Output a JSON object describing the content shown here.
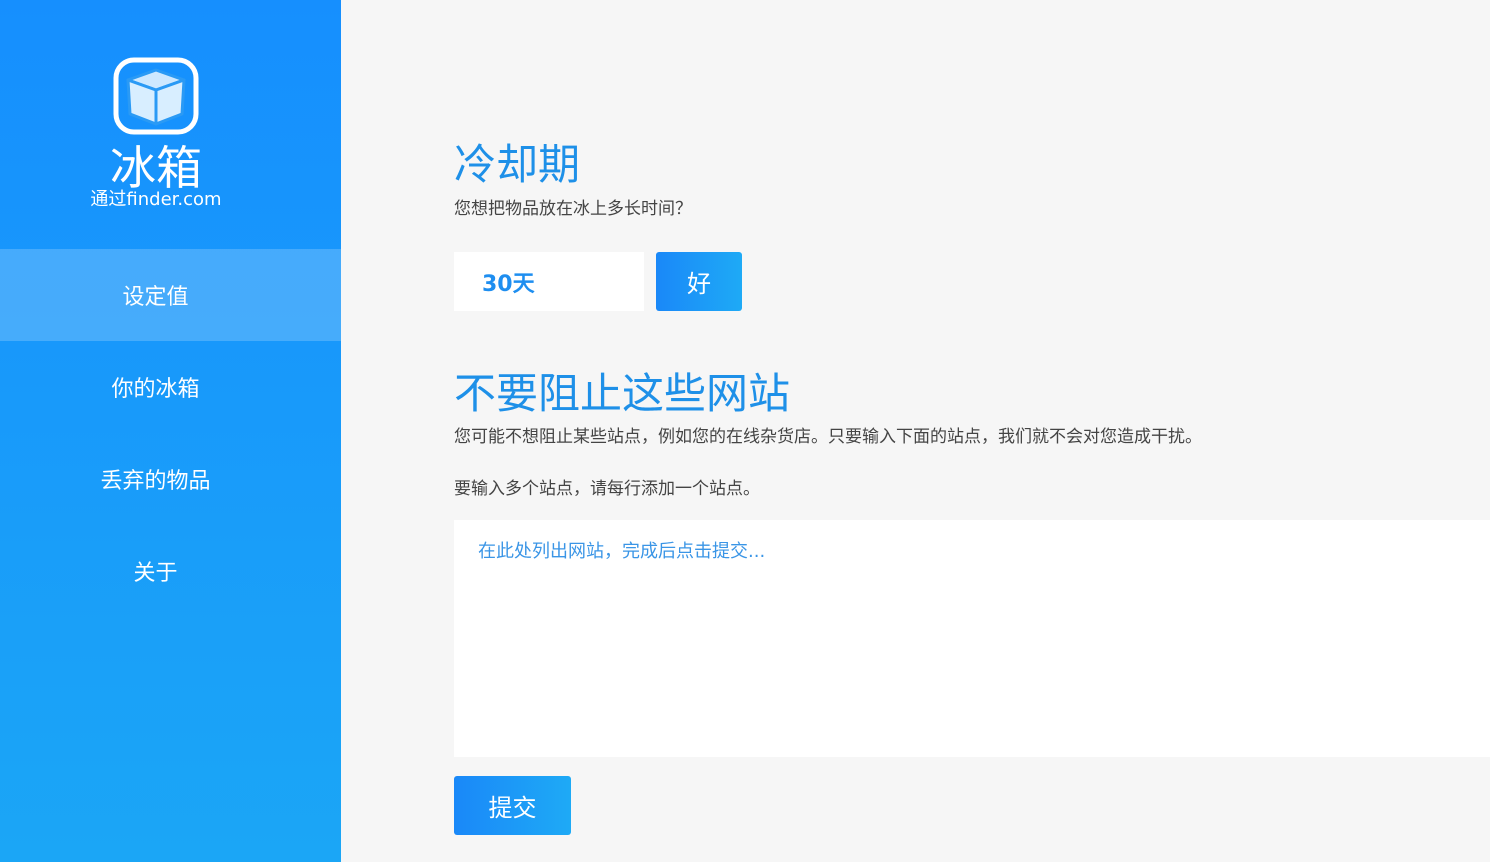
{
  "sidebar": {
    "logo_icon": "ice-cube-icon",
    "title": "冰箱",
    "subtitle": "通过finder.com",
    "items": [
      {
        "label": "设定值",
        "active": true
      },
      {
        "label": "你的冰箱",
        "active": false
      },
      {
        "label": "丢弃的物品",
        "active": false
      },
      {
        "label": "关于",
        "active": false
      }
    ]
  },
  "cooldown": {
    "heading": "冷却期",
    "description": "您想把物品放在冰上多长时间？",
    "value": "30天",
    "ok_label": "好"
  },
  "whitelist": {
    "heading": "不要阻止这些网站",
    "description": "您可能不想阻止某些站点，例如您的在线杂货店。只要输入下面的站点，我们就不会对您造成干扰。",
    "hint": "要输入多个站点，请每行添加一个站点。",
    "placeholder": "在此处列出网站，完成后点击提交...",
    "submit_label": "提交"
  },
  "colors": {
    "accent": "#1e90e8",
    "sidebar_top": "#168ffe",
    "sidebar_bottom": "#1ba6f6",
    "background": "#f6f6f6"
  }
}
